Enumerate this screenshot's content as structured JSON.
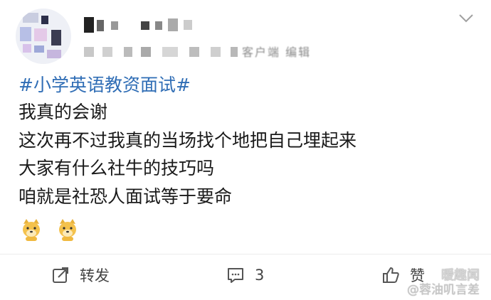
{
  "post": {
    "topic": "#小学英语教资面试#",
    "lines": [
      "我真的会谢",
      "这次再不过我真的当场找个地把自己埋起来",
      "大家有什么社牛的技巧吗",
      "咱就是社恐人面试等于要命"
    ],
    "emojis": [
      "doge-emoji",
      "doge-emoji"
    ]
  },
  "header": {
    "meta_visible": "客户端 编辑",
    "menu_icon": "chevron-down-icon"
  },
  "actions": {
    "repost_label": "转发",
    "comment_count": "3",
    "like_label": "赞"
  },
  "watermark": {
    "line1": "暖趣闻",
    "line2": "@蓉油叽言差"
  },
  "colors": {
    "topic": "#2f6db5",
    "text": "#1a1a1a",
    "icon": "#555555"
  }
}
